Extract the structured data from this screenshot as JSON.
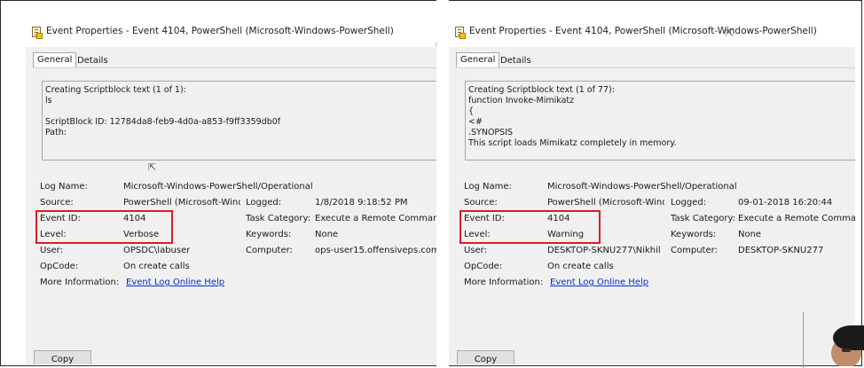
{
  "windows": [
    {
      "id": "left",
      "title": "Event Properties - Event 4104, PowerShell (Microsoft-Windows-PowerShell)",
      "tabs": [
        {
          "label": "General",
          "active": true
        },
        {
          "label": "Details",
          "active": false
        }
      ],
      "description": [
        "Creating Scriptblock text (1 of 1):",
        "ls",
        "",
        "ScriptBlock ID: 12784da8-feb9-4d0a-a853-f9ff3359db0f",
        "Path:"
      ],
      "fields": {
        "log_name_label": "Log Name:",
        "log_name": "Microsoft-Windows-PowerShell/Operational",
        "source_label": "Source:",
        "source": "PowerShell (Microsoft-Windc",
        "logged_label": "Logged:",
        "logged": "1/8/2018 9:18:52 PM",
        "event_id_label": "Event ID:",
        "event_id": "4104",
        "task_category_label": "Task Category:",
        "task_category": "Execute a Remote Command",
        "level_label": "Level:",
        "level": "Verbose",
        "keywords_label": "Keywords:",
        "keywords": "None",
        "user_label": "User:",
        "user": "OPSDC\\labuser",
        "computer_label": "Computer:",
        "computer": "ops-user15.offensiveps.com",
        "opcode_label": "OpCode:",
        "opcode": "On create calls",
        "more_info_label": "More Information:",
        "more_info_link": "Event Log Online Help"
      },
      "copy_button": "Copy"
    },
    {
      "id": "right",
      "title": "Event Properties - Event 4104, PowerShell (Microsoft-Windows-PowerShell)",
      "tabs": [
        {
          "label": "General",
          "active": true
        },
        {
          "label": "Details",
          "active": false
        }
      ],
      "description": [
        "Creating Scriptblock text (1 of 77):",
        "function Invoke-Mimikatz",
        "{",
        "<#",
        ".SYNOPSIS",
        "This script loads Mimikatz completely in memory."
      ],
      "fields": {
        "log_name_label": "Log Name:",
        "log_name": "Microsoft-Windows-PowerShell/Operational",
        "source_label": "Source:",
        "source": "PowerShell (Microsoft-Windc",
        "logged_label": "Logged:",
        "logged": "09-01-2018 16:20:44",
        "event_id_label": "Event ID:",
        "event_id": "4104",
        "task_category_label": "Task Category:",
        "task_category": "Execute a Remote Command",
        "level_label": "Level:",
        "level": "Warning",
        "keywords_label": "Keywords:",
        "keywords": "None",
        "user_label": "User:",
        "user": "DESKTOP-SKNU277\\Nikhil",
        "computer_label": "Computer:",
        "computer": "DESKTOP-SKNU277",
        "opcode_label": "OpCode:",
        "opcode": "On create calls",
        "more_info_label": "More Information:",
        "more_info_link": "Event Log Online Help"
      },
      "copy_button": "Copy"
    }
  ],
  "colors": {
    "highlight": "#d3202a",
    "link": "#0a2ec0",
    "panel_bg": "#f0f0f0"
  }
}
